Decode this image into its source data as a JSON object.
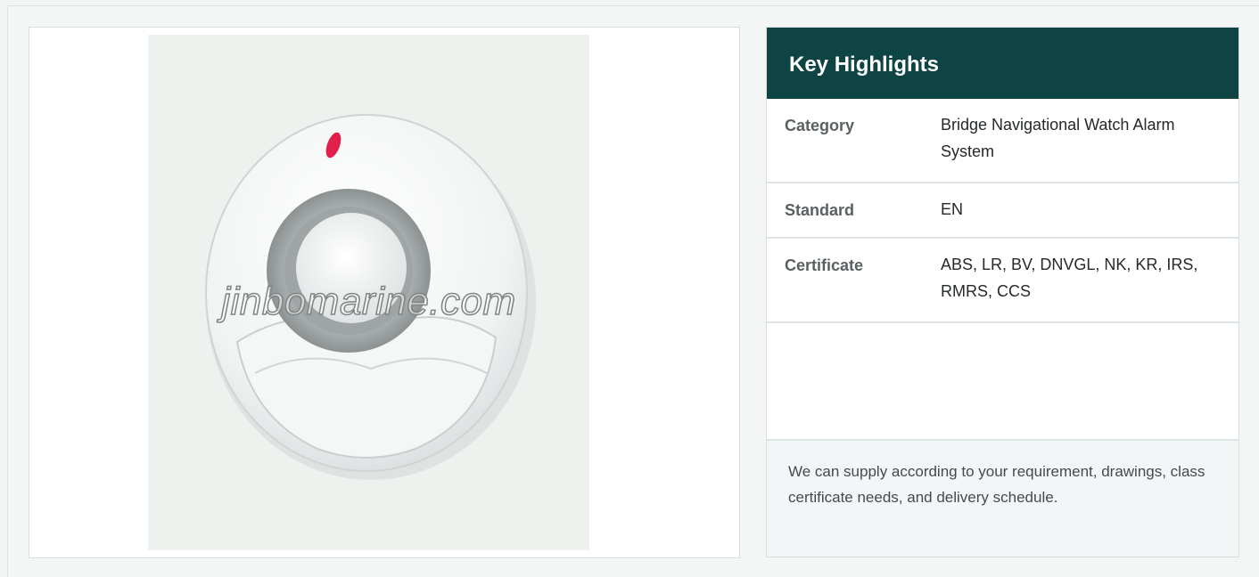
{
  "product_image": {
    "watermark": "jinbomarine.com",
    "alt": "Bridge Navigational Watch Alarm System"
  },
  "highlights": {
    "title": "Key Highlights",
    "rows": [
      {
        "key": "Category",
        "value": "Bridge Navigational Watch Alarm System"
      },
      {
        "key": "Standard",
        "value": "EN"
      },
      {
        "key": "Certificate",
        "value": "ABS, LR, BV, DNVGL, NK, KR, IRS, RMRS, CCS"
      },
      {
        "key": "",
        "value": ""
      }
    ],
    "note": "We can supply according to your requirement, drawings, class certificate needs, and delivery schedule."
  }
}
